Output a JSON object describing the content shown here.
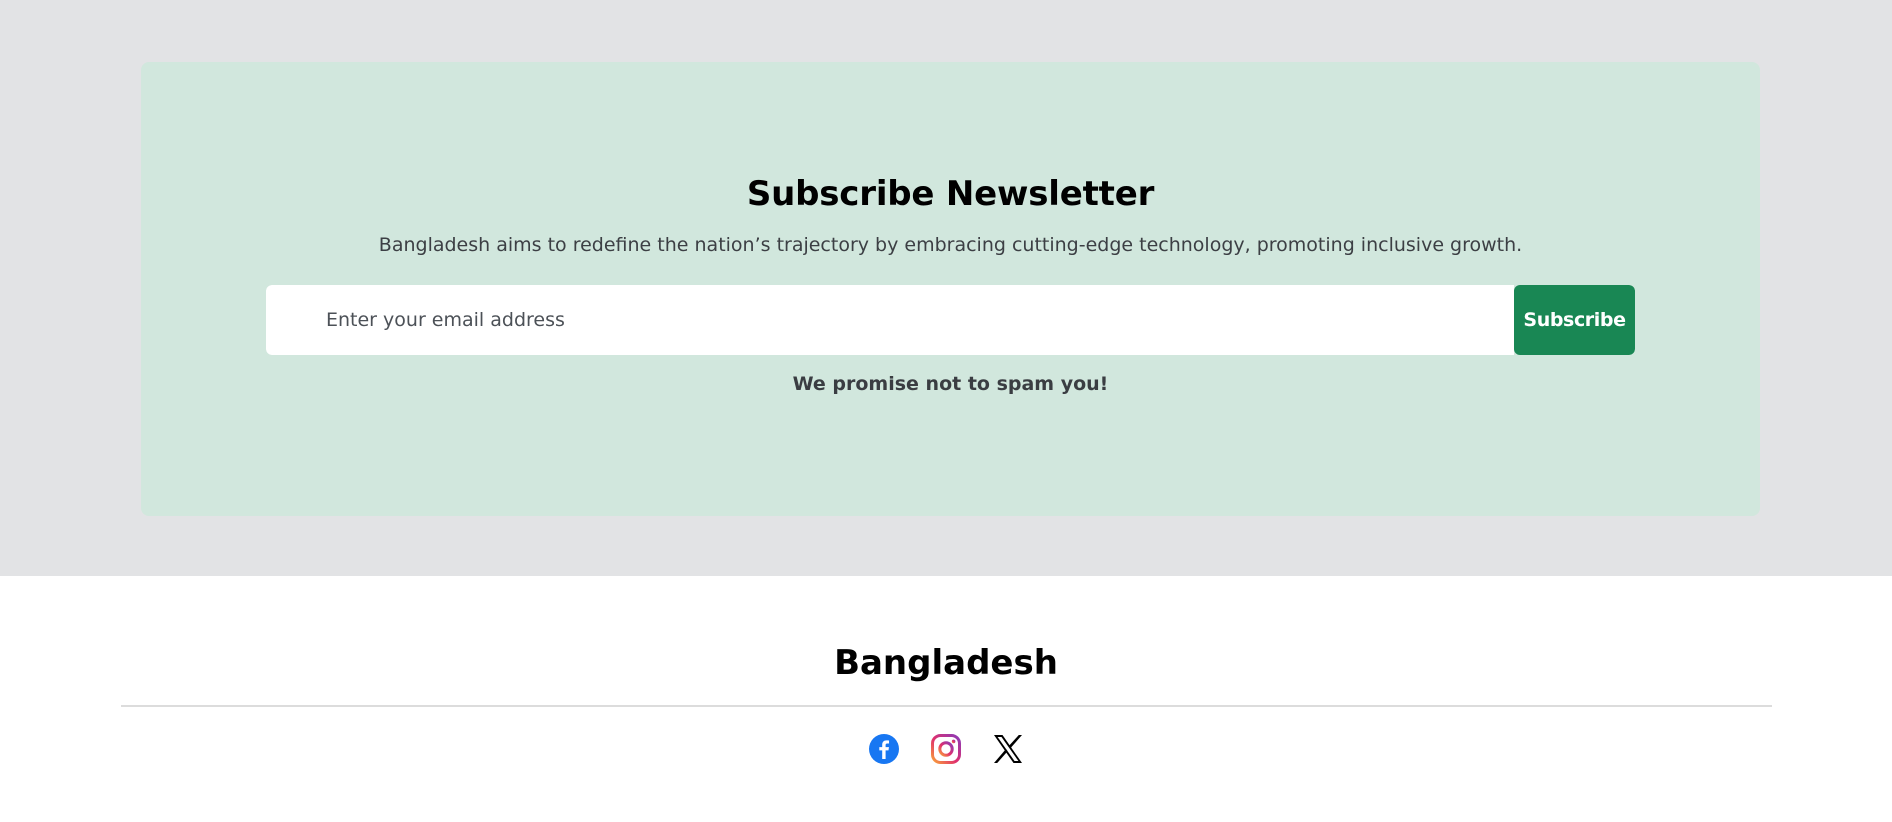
{
  "newsletter": {
    "title": "Subscribe Newsletter",
    "description": "Bangladesh aims to redefine the nation’s trajectory by embracing cutting-edge technology, promoting inclusive growth.",
    "email_placeholder": "Enter your email address",
    "email_value": "",
    "subscribe_label": "Subscribe",
    "note": "We promise not to spam you!"
  },
  "footer": {
    "brand": "Bangladesh",
    "social": [
      {
        "icon": "facebook-icon"
      },
      {
        "icon": "instagram-icon"
      },
      {
        "icon": "x-twitter-icon"
      }
    ]
  },
  "colors": {
    "page_bg": "#e2e3e5",
    "card_bg": "#d1e7dd",
    "button_bg": "#198754",
    "facebook": "#1877f2"
  }
}
